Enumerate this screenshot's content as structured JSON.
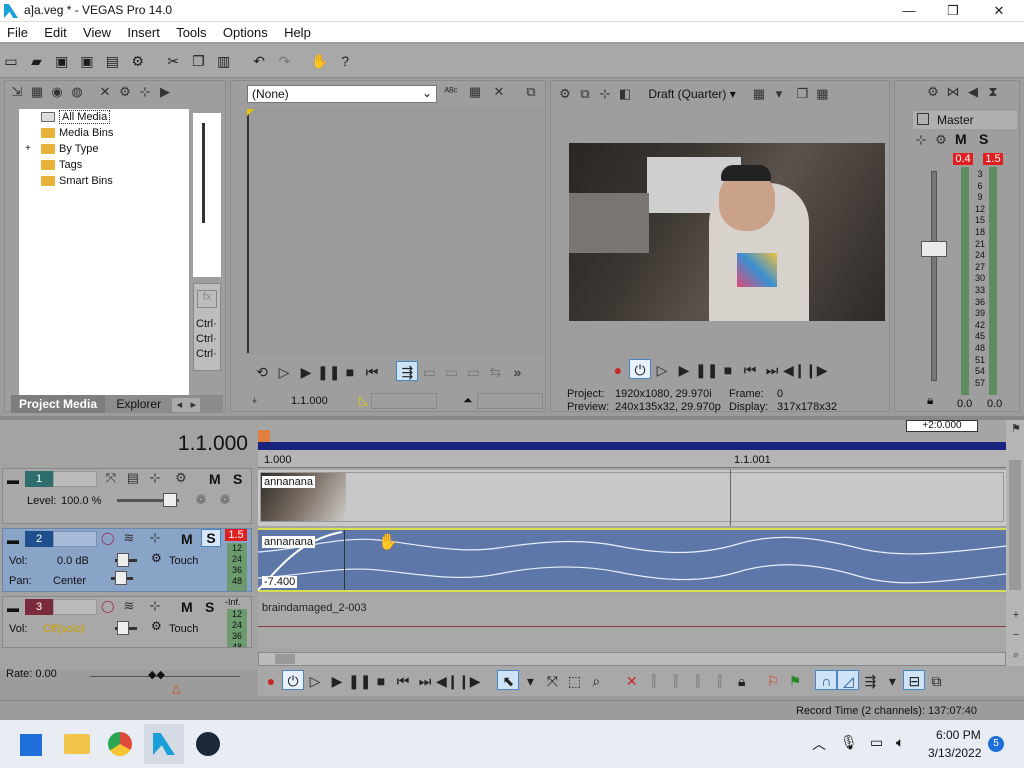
{
  "window": {
    "title": "a]a.veg * - VEGAS Pro 14.0",
    "minimize": "—",
    "maximize": "❐",
    "close": "✕"
  },
  "menu": [
    "File",
    "Edit",
    "View",
    "Insert",
    "Tools",
    "Options",
    "Help"
  ],
  "project_media": {
    "tree": [
      "All Media",
      "Media Bins",
      "By Type",
      "Tags",
      "Smart Bins"
    ],
    "expander": "+",
    "tabs": [
      "Project Media",
      "Explorer"
    ],
    "fx_list": [
      "Ctrl·",
      "Ctrl·",
      "Ctrl·"
    ]
  },
  "trimmer": {
    "preset": "(None)",
    "time": "1.1.000"
  },
  "preview": {
    "quality": "Draft (Quarter)",
    "project_label": "Project:",
    "project_value": "1920x1080, 29.970i",
    "preview_label": "Preview:",
    "preview_value": "240x135x32, 29.970p",
    "frame_label": "Frame:",
    "frame_value": "0",
    "display_label": "Display:",
    "display_value": "317x178x32"
  },
  "master": {
    "label": "Master",
    "peak_left": "0.4",
    "peak_right": "1.5",
    "scale": [
      "3",
      "6",
      "9",
      "12",
      "15",
      "18",
      "21",
      "24",
      "27",
      "30",
      "33",
      "36",
      "39",
      "42",
      "45",
      "48",
      "51",
      "54",
      "57"
    ],
    "readout_left": "0.0",
    "readout_right": "0.0"
  },
  "timeline": {
    "time": "1.1.000",
    "ruler": [
      "1.000",
      "1.1.001"
    ],
    "zoom_tooltip": "+2:0.000",
    "rate": "Rate: 0.00",
    "record_time": "Record Time (2 channels): 137:07:40"
  },
  "tracks": [
    {
      "num": "1",
      "level_label": "Level:",
      "level": "100.0 %",
      "clip": "annanana"
    },
    {
      "num": "2",
      "vol_label": "Vol:",
      "vol": "0.0 dB",
      "pan_label": "Pan:",
      "pan": "Center",
      "mode": "Touch",
      "clip": "annanana",
      "fade": "-7.400",
      "peak": "1.5",
      "meter": [
        "12",
        "24",
        "36",
        "48"
      ]
    },
    {
      "num": "3",
      "vol_label": "Vol:",
      "vol": "Off(solo)",
      "mode": "Touch",
      "clip": "braindamaged_2-003",
      "peak": "-Inf.",
      "meter": [
        "12",
        "24",
        "36",
        "48"
      ]
    }
  ],
  "taskbar": {
    "time": "6:00 PM",
    "date": "3/13/2022",
    "badge": "5"
  },
  "colors": {
    "accent_blue": "#1a237e",
    "selected_track": "#8aa4c8",
    "peak_red": "#e02020",
    "audio_clip": "#5d78a8",
    "solo_icon": "#2d6fb8"
  }
}
